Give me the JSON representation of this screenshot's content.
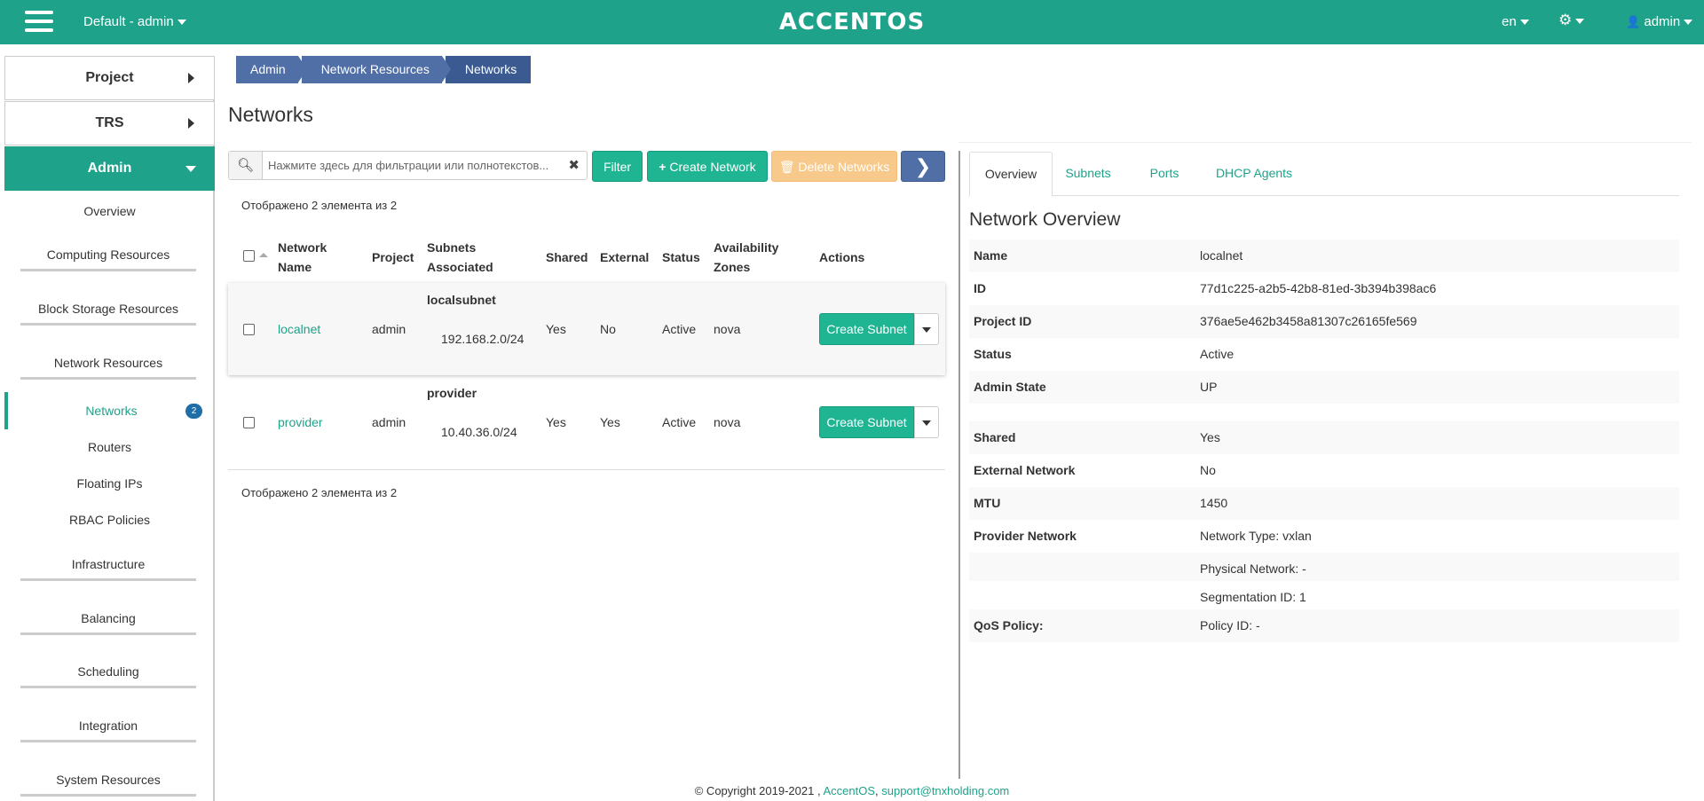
{
  "topbar": {
    "project_selector": "Default - admin",
    "logo_text": "ACCENTOS",
    "language": "en",
    "user": "admin",
    "accent_color": "#1fa28a"
  },
  "sidebar": {
    "sections": [
      {
        "label": "Project"
      },
      {
        "label": "TRS"
      },
      {
        "label": "Admin"
      }
    ],
    "items": [
      {
        "label": "Overview"
      },
      {
        "label": "Computing Resources"
      },
      {
        "label": "Block Storage Resources"
      },
      {
        "label": "Network Resources"
      },
      {
        "label": "Networks",
        "badge": "2"
      },
      {
        "label": "Routers"
      },
      {
        "label": "Floating IPs"
      },
      {
        "label": "RBAC Policies"
      },
      {
        "label": "Infrastructure"
      },
      {
        "label": "Balancing"
      },
      {
        "label": "Scheduling"
      },
      {
        "label": "Integration"
      },
      {
        "label": "System Resources"
      }
    ]
  },
  "breadcrumb": [
    "Admin",
    "Network Resources",
    "Networks"
  ],
  "page_title": "Networks",
  "toolbar": {
    "search_placeholder": "Нажмите здесь для фильтрации или полнотекстов...",
    "filter_label": "Filter",
    "create_label": "Create Network",
    "delete_label": "Delete Networks"
  },
  "table": {
    "count_text": "Отображено 2 элемента из 2",
    "headers": {
      "name_1": "Network",
      "name_2": "Name",
      "project": "Project",
      "subnets_1": "Subnets",
      "subnets_2": "Associated",
      "shared": "Shared",
      "external": "External",
      "status": "Status",
      "az_1": "Availability",
      "az_2": "Zones",
      "actions": "Actions"
    },
    "rows": [
      {
        "name": "localnet",
        "project": "admin",
        "subnet_name": "localsubnet",
        "subnet_cidr": "192.168.2.0/24",
        "shared": "Yes",
        "external": "No",
        "status": "Active",
        "az": "nova",
        "action": "Create Subnet"
      },
      {
        "name": "provider",
        "project": "admin",
        "subnet_name": "provider",
        "subnet_cidr": "10.40.36.0/24",
        "shared": "Yes",
        "external": "Yes",
        "status": "Active",
        "az": "nova",
        "action": "Create Subnet"
      }
    ]
  },
  "detail": {
    "tabs": [
      "Overview",
      "Subnets",
      "Ports",
      "DHCP Agents"
    ],
    "title": "Network Overview",
    "rows": [
      {
        "key": "Name",
        "value": "localnet"
      },
      {
        "key": "ID",
        "value": "77d1c225-a2b5-42b8-81ed-3b394b398ac6"
      },
      {
        "key": "Project ID",
        "value": "376ae5e462b3458a81307c26165fe569"
      },
      {
        "key": "Status",
        "value": "Active"
      },
      {
        "key": "Admin State",
        "value": "UP"
      },
      {
        "key": "Shared",
        "value": "Yes"
      },
      {
        "key": "External Network",
        "value": "No"
      },
      {
        "key": "MTU",
        "value": "1450"
      },
      {
        "key": "Provider Network",
        "value": "Network Type: vxlan"
      },
      {
        "key": "",
        "value": "Physical Network: -"
      },
      {
        "key": "",
        "value": "Segmentation ID: 1"
      },
      {
        "key": "QoS Policy:",
        "value": "Policy ID: -"
      }
    ]
  },
  "footer": {
    "copyright": "© Copyright 2019-2021 ,",
    "brand": "AccentOS",
    "separator": ",",
    "email": "support@tnxholding.com"
  }
}
